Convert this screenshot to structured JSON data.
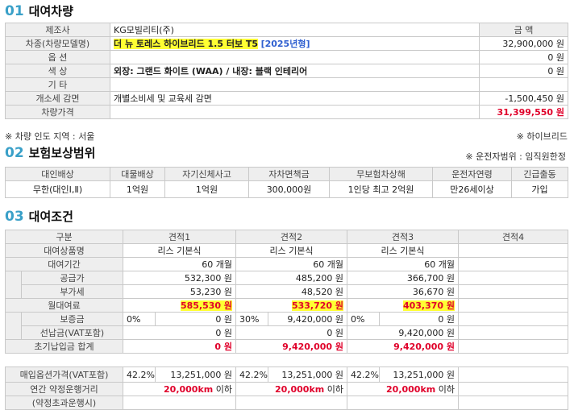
{
  "sec1": {
    "num": "01",
    "title": "대여차량"
  },
  "vehicle": {
    "maker_label": "제조사",
    "maker": "KG모빌리티(주)",
    "amount_header": "금 액",
    "model_label": "차종(차량모델명)",
    "model": "더 뉴 토레스 하이브리드 1.5 터보 T5",
    "model_year": "[2025년형]",
    "model_price": "32,900,000 원",
    "option_label": "옵 션",
    "option_price": "0 원",
    "color_label": "색 상",
    "color": "외장: 그랜드 화이트 (WAA) / 내장: 블랙 인테리어",
    "color_price": "0 원",
    "etc_label": "기 타",
    "tax_label": "개소세 감면",
    "tax": "개별소비세 및 교육세 감면",
    "tax_price": "-1,500,450 원",
    "total_label": "차량가격",
    "total_price": "31,399,550 원",
    "delivery_note": "※ 차량 인도 지역 : 서울",
    "hybrid_note": "※ 하이브리드"
  },
  "sec2": {
    "num": "02",
    "title": "보험보상범위",
    "note": "※ 운전자범위 : 임직원한정"
  },
  "insurance": {
    "headers": [
      "대인배상",
      "대물배상",
      "자기신체사고",
      "자차면책금",
      "무보험차상해",
      "운전자연령",
      "긴급출동"
    ],
    "values": [
      "무한(대인Ⅰ,Ⅱ)",
      "1억원",
      "1억원",
      "300,000원",
      "1인당 최고 2억원",
      "만26세이상",
      "가입"
    ]
  },
  "sec3": {
    "num": "03",
    "title": "대여조건"
  },
  "rental": {
    "col_header": "구분",
    "quotes": [
      "견적1",
      "견적2",
      "견적3",
      "견적4"
    ],
    "product_label": "대여상품명",
    "product": [
      "리스 기본식",
      "리스 기본식",
      "리스 기본식"
    ],
    "period_label": "대여기간",
    "period": [
      "60 개월",
      "60 개월",
      "60 개월"
    ],
    "supply_label": "공급가",
    "supply": [
      "532,300 원",
      "485,200 원",
      "366,700 원"
    ],
    "vat_label": "부가세",
    "vat": [
      "53,230 원",
      "48,520 원",
      "36,670 원"
    ],
    "monthly_label": "월대여료",
    "monthly": [
      "585,530 원",
      "533,720 원",
      "403,370 원"
    ],
    "deposit_label": "보증금",
    "deposit_pct": [
      "0%",
      "30%",
      "0%"
    ],
    "deposit": [
      "0 원",
      "9,420,000 원",
      "0 원"
    ],
    "prepay_label": "선납금(VAT포함)",
    "prepay": [
      "0 원",
      "0 원",
      "9,420,000 원"
    ],
    "initial_label": "초기납입금 합계",
    "initial": [
      "0 원",
      "9,420,000 원",
      "9,420,000 원"
    ],
    "buyout_label": "매입옵션가격(VAT포함)",
    "buyout_pct": [
      "42.2%",
      "42.2%",
      "42.2%"
    ],
    "buyout": [
      "13,251,000 원",
      "13,251,000 원",
      "13,251,000 원"
    ],
    "mileage_label": "연간 약정운행거리",
    "mileage": [
      "20,000km",
      "20,000km",
      "20,000km"
    ],
    "mileage_suffix": "이하",
    "extra_label": "(약정초과운행시)"
  }
}
